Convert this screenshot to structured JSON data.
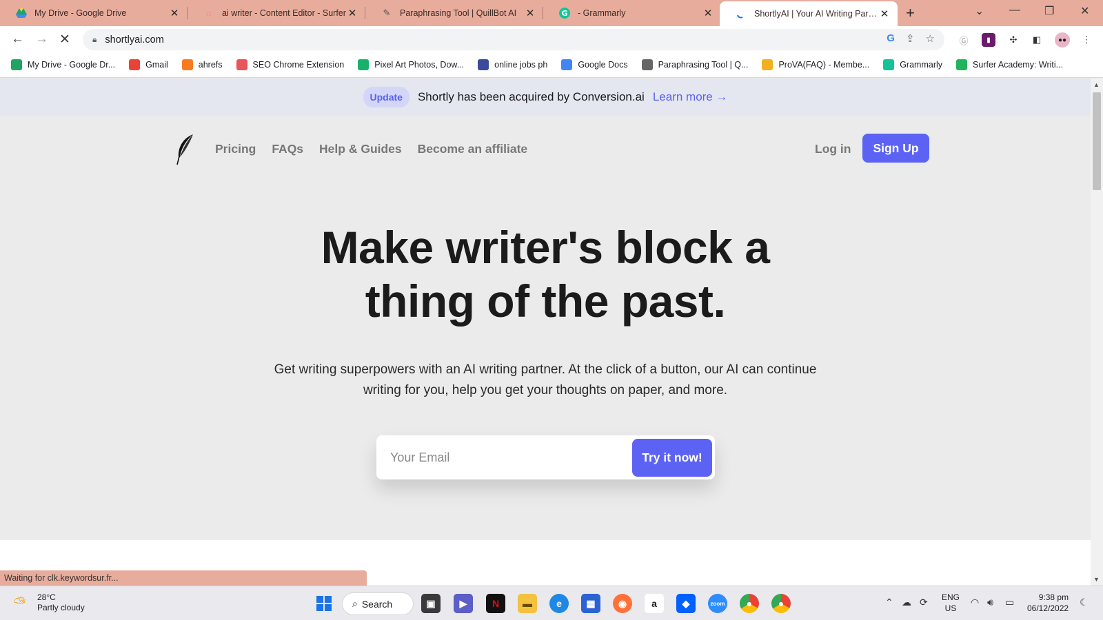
{
  "browser": {
    "tabs": [
      {
        "title": "My Drive - Google Drive",
        "favicon": "google-drive-icon"
      },
      {
        "title": "ai writer - Content Editor - Surfer",
        "favicon": "surfer-icon"
      },
      {
        "title": "Paraphrasing Tool | QuillBot AI",
        "favicon": "quillbot-icon"
      },
      {
        "title": "- Grammarly",
        "favicon": "grammarly-icon"
      },
      {
        "title": "ShortlyAI | Your AI Writing Partner",
        "favicon": "loading-spinner-icon",
        "active": true
      }
    ],
    "url": "shortlyai.com",
    "bookmarks": [
      {
        "label": "My Drive - Google Dr...",
        "icon": "google-drive-icon",
        "color": "#1fa463"
      },
      {
        "label": "Gmail",
        "icon": "gmail-icon",
        "color": "#ea4335"
      },
      {
        "label": "ahrefs",
        "icon": "ahrefs-icon",
        "color": "#f97a1f"
      },
      {
        "label": "SEO Chrome Extension",
        "icon": "seo-extension-icon",
        "color": "#e8555a"
      },
      {
        "label": "Pixel Art Photos, Dow...",
        "icon": "pixel-art-icon",
        "color": "#18b26b"
      },
      {
        "label": "online jobs ph",
        "icon": "online-jobs-icon",
        "color": "#3b4a9a"
      },
      {
        "label": "Google Docs",
        "icon": "google-docs-icon",
        "color": "#4285f4"
      },
      {
        "label": "Paraphrasing Tool | Q...",
        "icon": "quillbot-icon",
        "color": "#666666"
      },
      {
        "label": "ProVA(FAQ) - Membe...",
        "icon": "prova-icon",
        "color": "#f2b01e"
      },
      {
        "label": "Grammarly",
        "icon": "grammarly-icon",
        "color": "#15c39a"
      },
      {
        "label": "Surfer Academy: Writi...",
        "icon": "surfer-academy-icon",
        "color": "#22b35c"
      }
    ],
    "status_text": "Waiting for clk.keywordsur.fr..."
  },
  "page": {
    "banner": {
      "badge": "Update",
      "text": "Shortly has been acquired by Conversion.ai",
      "link": "Learn more →"
    },
    "nav": {
      "links": [
        "Pricing",
        "FAQs",
        "Help & Guides",
        "Become an affiliate"
      ],
      "login": "Log in",
      "signup": "Sign Up"
    },
    "hero": {
      "line1": "Make writer's block a",
      "line2": "thing of the past.",
      "subtitle_line1": "Get writing superpowers with an AI writing partner. At the click of a button, our AI can continue",
      "subtitle_line2": "writing for you, help you get your thoughts on paper, and more."
    },
    "signup_form": {
      "email_placeholder": "Your Email",
      "button": "Try it now!"
    },
    "accent_color": "#5c63f4"
  },
  "taskbar": {
    "weather_temp": "28°C",
    "weather_desc": "Partly cloudy",
    "search_label": "Search",
    "lang": "ENG",
    "region": "US",
    "time": "9:38 pm",
    "date": "06/12/2022"
  }
}
